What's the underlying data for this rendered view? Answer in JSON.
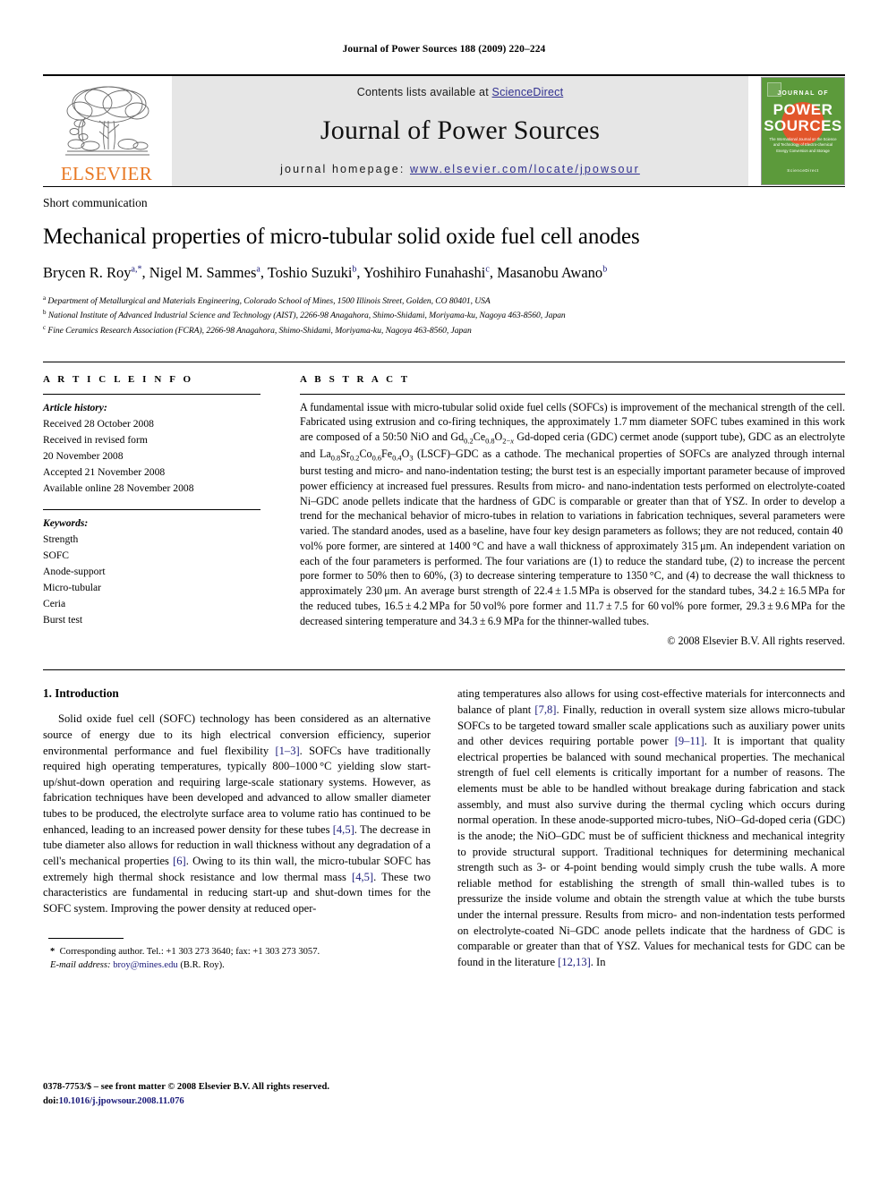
{
  "running_head": "Journal of Power Sources 188 (2009) 220–224",
  "masthead": {
    "publisher_name": "ELSEVIER",
    "contents_prefix": "Contents lists available at ",
    "sciencedirect": "ScienceDirect",
    "journal_name": "Journal of Power Sources",
    "homepage_prefix": "journal homepage:",
    "homepage_url": "www.elsevier.com/locate/jpowsour",
    "cover": {
      "line1": "JOURNAL OF",
      "line2": "POWER",
      "line3": "SOURCES",
      "tagline": "The International Journal on the Science and Technology of Electro-chemical Energy Conversion and Storage",
      "sciencedirect": "ScienceDirect",
      "green": "#5C9A3B",
      "orange": "#E2562B"
    },
    "brand_orange": "#E87722",
    "band_gray": "#e6e6e6",
    "link_blue": "#2f2f8f"
  },
  "article": {
    "type": "Short communication",
    "title": "Mechanical properties of micro-tubular solid oxide fuel cell anodes",
    "authors_html": "Brycen R. Roy<sup class=\"star\">a,*</sup>, Nigel M. Sammes<sup>a</sup>, Toshio Suzuki<sup>b</sup>, Yoshihiro Funahashi<sup>c</sup>, Masanobu Awano<sup>b</sup>",
    "affiliations": [
      "Department of Metallurgical and Materials Engineering, Colorado School of Mines, 1500 Illinois Street, Golden, CO 80401, USA",
      "National Institute of Advanced Industrial Science and Technology (AIST), 2266-98 Anagahora, Shimo-Shidami, Moriyama-ku, Nagoya 463-8560, Japan",
      "Fine Ceramics Research Association (FCRA), 2266-98 Anagahora, Shimo-Shidami, Moriyama-ku, Nagoya 463-8560, Japan"
    ],
    "affiliation_marks": [
      "a",
      "b",
      "c"
    ]
  },
  "article_info": {
    "heading": "A R T I C L E   I N F O",
    "history_title": "Article history:",
    "history": [
      "Received 28 October 2008",
      "Received in revised form",
      "20 November 2008",
      "Accepted 21 November 2008",
      "Available online 28 November 2008"
    ],
    "keywords_title": "Keywords:",
    "keywords": [
      "Strength",
      "SOFC",
      "Anode-support",
      "Micro-tubular",
      "Ceria",
      "Burst test"
    ]
  },
  "abstract": {
    "heading": "A B S T R A C T",
    "text_html": "A fundamental issue with micro-tubular solid oxide fuel cells (SOFCs) is improvement of the mechanical strength of the cell. Fabricated using extrusion and co-firing techniques, the approximately 1.7&thinsp;mm diameter SOFC tubes examined in this work are composed of a 50:50 NiO and Gd<sub>0.2</sub>Ce<sub>0.8</sub>O<sub>2&minus;<i>x</i></sub> Gd-doped ceria (GDC) cermet anode (support tube), GDC as an electrolyte and La<sub>0.8</sub>Sr<sub>0.2</sub>Co<sub>0.6</sub>Fe<sub>0.4</sub>O<sub>3</sub> (LSCF)&ndash;GDC as a cathode. The mechanical properties of SOFCs are analyzed through internal burst testing and micro- and nano-indentation testing; the burst test is an especially important parameter because of improved power efficiency at increased fuel pressures. Results from micro- and nano-indentation tests performed on electrolyte-coated Ni&ndash;GDC anode pellets indicate that the hardness of GDC is comparable or greater than that of YSZ. In order to develop a trend for the mechanical behavior of micro-tubes in relation to variations in fabrication techniques, several parameters were varied. The standard anodes, used as a baseline, have four key design parameters as follows; they are not reduced, contain 40&thinsp;vol% pore former, are sintered at 1400&thinsp;&deg;C and have a wall thickness of approximately 315&thinsp;&mu;m. An independent variation on each of the four parameters is performed. The four variations are (1) to reduce the standard tube, (2) to increase the percent pore former to 50% then to 60%, (3) to decrease sintering temperature to 1350&thinsp;&deg;C, and (4) to decrease the wall thickness to approximately 230&thinsp;&mu;m. An average burst strength of 22.4&thinsp;&plusmn;&thinsp;1.5&thinsp;MPa is observed for the standard tubes, 34.2&thinsp;&plusmn;&thinsp;16.5&thinsp;MPa for the reduced tubes, 16.5&thinsp;&plusmn;&thinsp;4.2&thinsp;MPa for 50&thinsp;vol% pore former and 11.7&thinsp;&plusmn;&thinsp;7.5 for 60&thinsp;vol% pore former, 29.3&thinsp;&plusmn;&thinsp;9.6&thinsp;MPa for the decreased sintering temperature and 34.3&thinsp;&plusmn;&thinsp;6.9&thinsp;MPa for the thinner-walled tubes.",
    "copyright": "© 2008 Elsevier B.V. All rights reserved."
  },
  "body": {
    "section_number_title": "1.  Introduction",
    "left_paragraph_html": "Solid oxide fuel cell (SOFC) technology has been considered as an alternative source of energy due to its high electrical conversion efficiency, superior environmental performance and fuel flexibility <span class=\"ref\">[1&ndash;3]</span>. SOFCs have traditionally required high operating temperatures, typically 800&ndash;1000&thinsp;&deg;C yielding slow start-up/shut-down operation and requiring large-scale stationary systems. However, as fabrication techniques have been developed and advanced to allow smaller diameter tubes to be produced, the electrolyte surface area to volume ratio has continued to be enhanced, leading to an increased power density for these tubes <span class=\"ref\">[4,5]</span>. The decrease in tube diameter also allows for reduction in wall thickness without any degradation of a cell's mechanical properties <span class=\"ref\">[6]</span>. Owing to its thin wall, the micro-tubular SOFC has extremely high thermal shock resistance and low thermal mass <span class=\"ref\">[4,5]</span>. These two characteristics are fundamental in reducing start-up and shut-down times for the SOFC system. Improving the power density at reduced oper-",
    "right_paragraph_html": "ating temperatures also allows for using cost-effective materials for interconnects and balance of plant <span class=\"ref\">[7,8]</span>. Finally, reduction in overall system size allows micro-tubular SOFCs to be targeted toward smaller scale applications such as auxiliary power units and other devices requiring portable power <span class=\"ref\">[9&ndash;11]</span>. It is important that quality electrical properties be balanced with sound mechanical properties. The mechanical strength of fuel cell elements is critically important for a number of reasons. The elements must be able to be handled without breakage during fabrication and stack assembly, and must also survive during the thermal cycling which occurs during normal operation. In these anode-supported micro-tubes, NiO&ndash;Gd-doped ceria (GDC) is the anode; the NiO&ndash;GDC must be of sufficient thickness and mechanical integrity to provide structural support. Traditional techniques for determining mechanical strength such as 3- or 4-point bending would simply crush the tube walls. A more reliable method for establishing the strength of small thin-walled tubes is to pressurize the inside volume and obtain the strength value at which the tube bursts under the internal pressure. Results from micro- and non-indentation tests performed on electrolyte-coated Ni&ndash;GDC anode pellets indicate that the hardness of GDC is comparable or greater than that of YSZ. Values for mechanical tests for GDC can be found in the literature <span class=\"ref\">[12,13]</span>. In"
  },
  "footnote": {
    "corresponding_html": "<b>*</b>&nbsp;&nbsp;Corresponding author. Tel.: +1 303 273 3640; fax: +1 303 273 3057.",
    "email_html": "<i>E-mail address:</i> <span class=\"fn-mail\">broy@mines.edu</span> (B.R. Roy)."
  },
  "footer": {
    "issn_html": "0378-7753/$ &ndash; see front matter &copy; 2008 Elsevier B.V. All rights reserved.",
    "doi_html": "doi:<span class=\"doi-link\">10.1016/j.jpowsour.2008.11.076</span>"
  }
}
